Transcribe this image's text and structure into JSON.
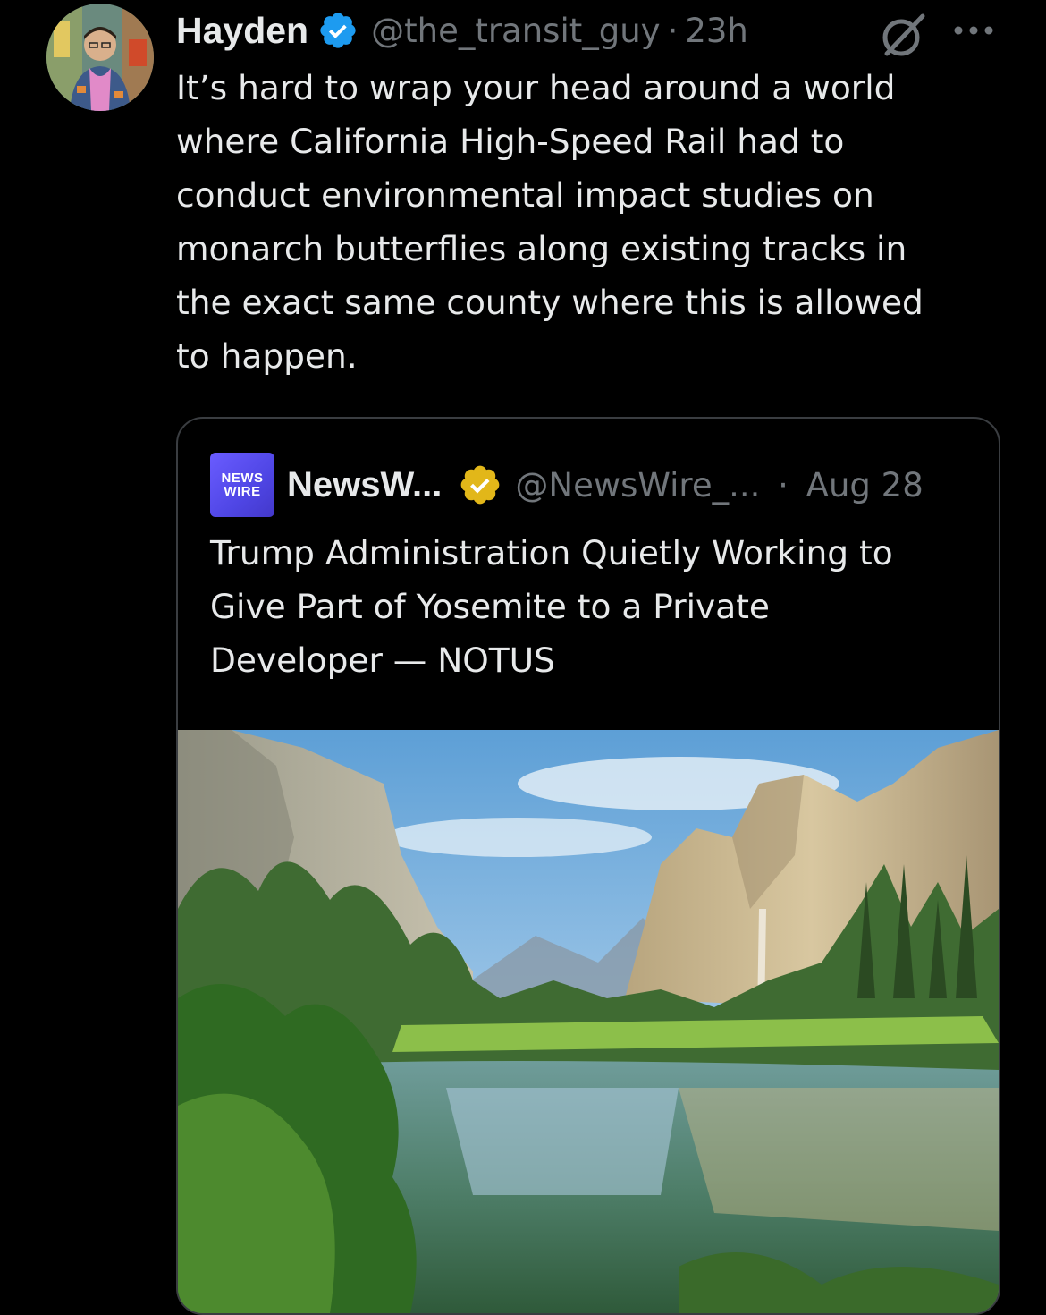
{
  "tweet": {
    "display_name": "Hayden",
    "handle": "@the_transit_guy",
    "separator": "·",
    "time": "23h",
    "text": "It’s hard to wrap your head around a world\nwhere California High-Speed Rail had to\nconduct environmental impact studies on\nmonarch butterflies along existing tracks in\nthe exact same county where this is allowed\nto happen.",
    "icons": {
      "verified": "blue-verified-badge-icon",
      "grok": "grok-icon",
      "more": "more-options-icon"
    }
  },
  "quoted_tweet": {
    "logo_text_top": "NEWS",
    "logo_text_bottom": "WIRE",
    "display_name": "NewsW...",
    "handle": "@NewsWire_...",
    "separator": "·",
    "date": "Aug 28",
    "text": "Trump Administration Quietly Working to\nGive Part of Yosemite to a Private\nDeveloper — NOTUS",
    "icons": {
      "verified": "gold-verified-badge-icon"
    },
    "image": "yosemite-valley-river-photo"
  },
  "colors": {
    "background": "#000000",
    "primary_text": "#e7e9ea",
    "secondary_text": "#71767b",
    "verified_blue": "#1d9bf0",
    "verified_gold": "#e2b719",
    "card_border": "#3a3d41"
  }
}
